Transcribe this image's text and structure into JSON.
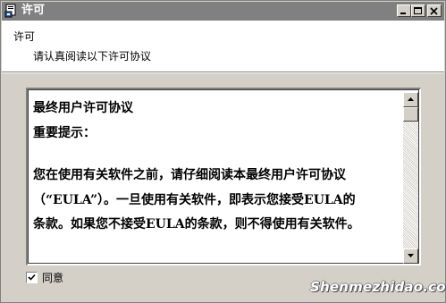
{
  "window": {
    "title": "许可",
    "title_icon": "installer-icon"
  },
  "header": {
    "title": "许可",
    "subtitle": "请认真阅读以下许可协议"
  },
  "license": {
    "lines": [
      "最终用户许可协议",
      "重要提示：",
      "您在使用有关软件之前，请仔细阅读本最终用户许可协议",
      "（“EULA”）。一旦使用有关软件，即表示您接受EULA的",
      "条款。如果您不接受EULA的条款，则不得使用有关软件。"
    ]
  },
  "agree": {
    "label": "同意",
    "checked": true
  },
  "watermark": "Shenmezhidao.com",
  "colors": {
    "titlebar": "#808080",
    "face": "#d4d0c8",
    "panel": "#ffffff"
  }
}
